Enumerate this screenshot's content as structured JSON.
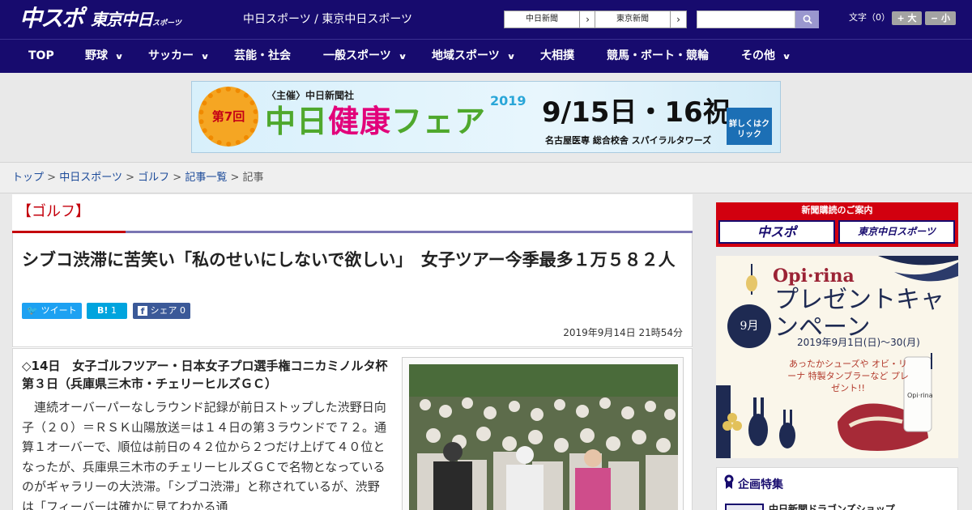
{
  "header": {
    "logo_primary": "中スポ",
    "logo_secondary": "東京中日",
    "logo_secondary_small": "スポーツ",
    "site_title": "中日スポーツ / 東京中日スポーツ",
    "paper_links": [
      "中日新聞",
      "東京新聞"
    ],
    "search_placeholder": "",
    "font_size_label": "文字（0）",
    "font_larger_label": "+ 大",
    "font_smaller_label": "− 小"
  },
  "nav": {
    "items": [
      {
        "label": "TOP",
        "has_menu": false
      },
      {
        "label": "野球",
        "has_menu": true
      },
      {
        "label": "サッカー",
        "has_menu": true
      },
      {
        "label": "芸能・社会",
        "has_menu": false
      },
      {
        "label": "一般スポーツ",
        "has_menu": true
      },
      {
        "label": "地域スポーツ",
        "has_menu": true
      },
      {
        "label": "大相撲",
        "has_menu": false
      },
      {
        "label": "競馬・ボート・競輪",
        "has_menu": false
      },
      {
        "label": "その他",
        "has_menu": true
      }
    ]
  },
  "banner": {
    "badge": "第7回",
    "host": "〈主催〉中日新聞社",
    "title_a": "中日",
    "title_b": "健康",
    "title_c": "フェア",
    "year": "2019",
    "date": "9/15日・16祝",
    "venue": "名古屋医専 総合校舎 スパイラルタワーズ",
    "cta": "詳しくはクリック"
  },
  "breadcrumb": {
    "links": [
      "トップ",
      "中日スポーツ",
      "ゴルフ",
      "記事一覧"
    ],
    "current": "記事",
    "separator": ">"
  },
  "article": {
    "category": "【ゴルフ】",
    "headline": "シブコ渋滞に苦笑い「私のせいにしないで欲しい」　女子ツアー今季最多１万５８２人",
    "share": {
      "tweet_label": "ツイート",
      "hatena_label": "B!",
      "hatena_count": "1",
      "facebook_label": "シェア",
      "facebook_count": "0"
    },
    "published": "2019年9月14日 21時54分",
    "lead": "◇14日　女子ゴルフツアー・日本女子プロ選手権コニカミノルタ杯第３日（兵庫県三木市・チェリーヒルズＧＣ）",
    "paragraph": "連続オーバーパーなしラウンド記録が前日ストップした渋野日向子（２０）＝ＲＳＫ山陽放送＝は１４日の第３ラウンドで７２。通算１オーバーで、順位は前日の４２位から２つだけ上げて４０位となったが、兵庫県三木市のチェリーヒルズＧＣで名物となっているのがギャラリーの大渋滞。「シブコ渋滞」と称されているが、渋野は「フィーバーは確かに見てわかる通"
  },
  "sidebar": {
    "subscribe_heading": "新聞購読のご案内",
    "subscribe_buttons": [
      "中スポ",
      "東京中日スポーツ"
    ],
    "ad": {
      "brand": "Opi·rina",
      "title": "プレゼントキャンペーン",
      "month": "9月",
      "period": "2019年9月1日(日)〜30(月)",
      "copy": "あったかシューズや オビ・リーナ 特製タンブラーなど プレゼント!!"
    },
    "feature_label": "企画特集",
    "feature_sub": "中日新聞ドラゴンズショップ"
  },
  "colors": {
    "header_bg": "#170b6e",
    "accent_red": "#c4000c",
    "twitter": "#1da1f2",
    "hatena": "#00a4de",
    "facebook": "#3b5998"
  }
}
